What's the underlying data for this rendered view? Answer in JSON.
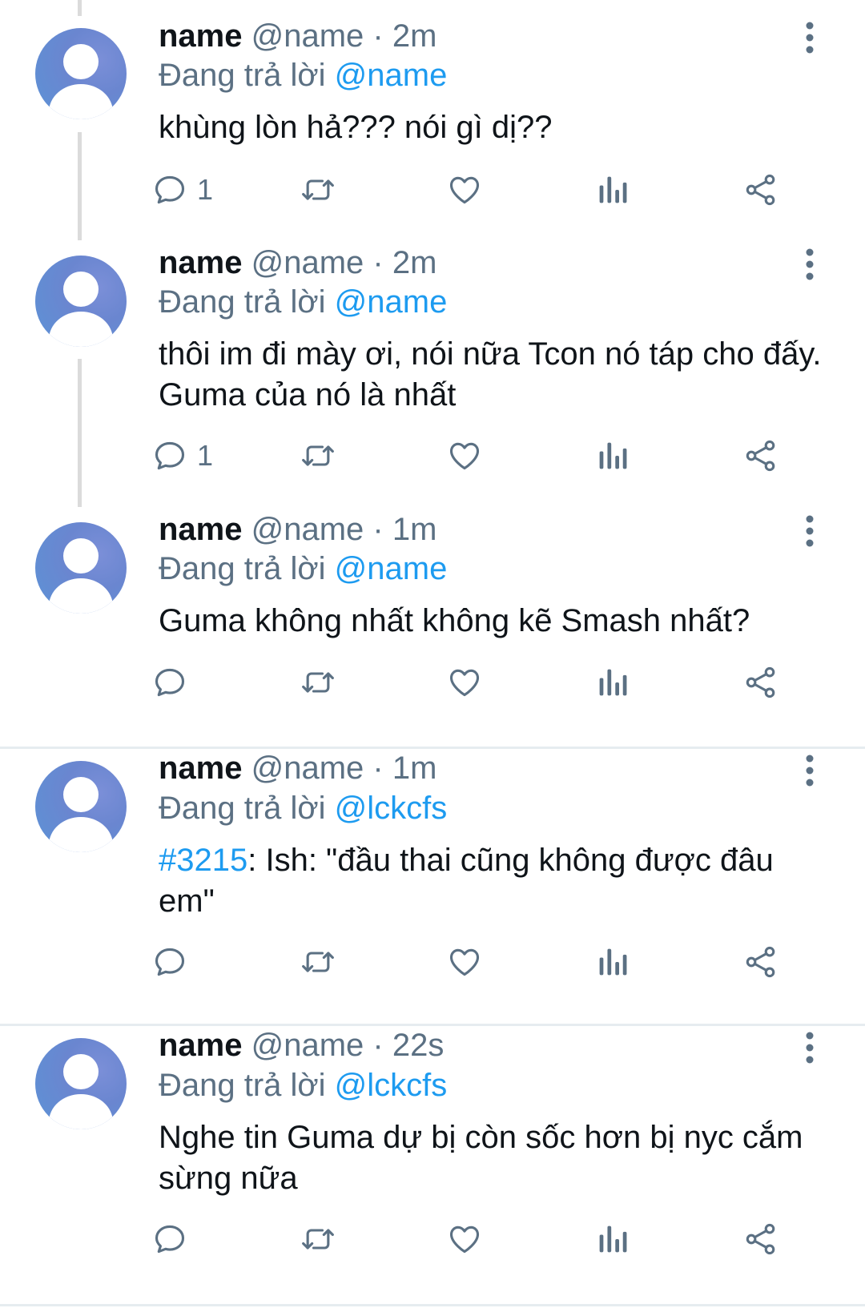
{
  "tweets": [
    {
      "name": "name",
      "handle": "@name",
      "time": "2m",
      "replying_prefix": "Đang trả lời",
      "replying_to": "@name",
      "hashtag": "",
      "text": "khùng lòn hả??? nói gì dị??",
      "reply_count": "1"
    },
    {
      "name": "name",
      "handle": "@name",
      "time": "2m",
      "replying_prefix": "Đang trả lời",
      "replying_to": "@name",
      "hashtag": "",
      "text": "thôi im đi mày ơi, nói nữa Tcon nó táp cho đấy. Guma của nó là nhất",
      "reply_count": "1"
    },
    {
      "name": "name",
      "handle": "@name",
      "time": "1m",
      "replying_prefix": "Đang trả lời",
      "replying_to": "@name",
      "hashtag": "",
      "text": "Guma không nhất không kẽ Smash nhất?",
      "reply_count": ""
    },
    {
      "name": "name",
      "handle": "@name",
      "time": "1m",
      "replying_prefix": "Đang trả lời",
      "replying_to": "@lckcfs",
      "hashtag": "#3215",
      "text": ": Ish: \"đầu thai cũng không được đâu em\"",
      "reply_count": ""
    },
    {
      "name": "name",
      "handle": "@name",
      "time": "22s",
      "replying_prefix": "Đang trả lời",
      "replying_to": "@lckcfs",
      "hashtag": "",
      "text": "Nghe tin Guma dự bị còn sốc hơn bị nyc cắm sừng nữa",
      "reply_count": ""
    }
  ],
  "separator": " · ",
  "icons": {
    "more": "more-vertical-icon",
    "reply": "reply-icon",
    "retweet": "retweet-icon",
    "like": "like-icon",
    "views": "views-icon",
    "share": "share-icon"
  },
  "colors": {
    "accent": "#1d9bf0",
    "muted": "#5b7083",
    "text": "#0f1419",
    "thread_line": "#dbdbdb",
    "divider": "#e6ecf0"
  }
}
